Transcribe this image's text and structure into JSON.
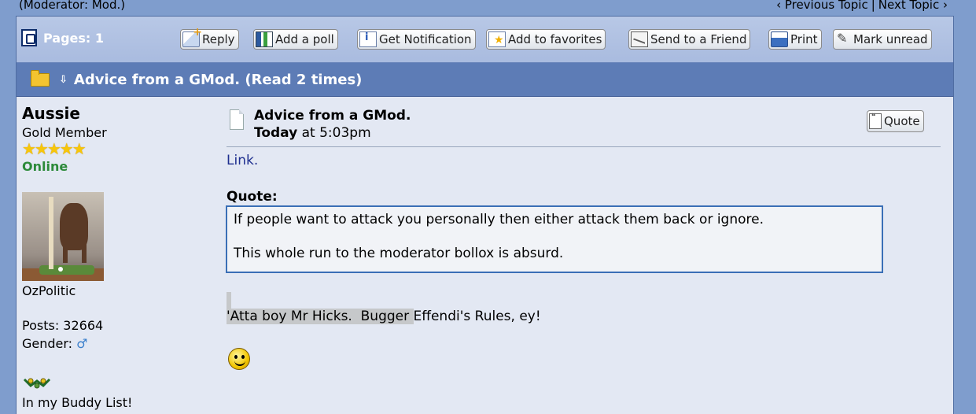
{
  "top": {
    "moderator": "(Moderator: Mod.)",
    "previous_topic": "‹ Previous Topic",
    "separator": "|",
    "next_topic": "Next Topic ›"
  },
  "toolbar": {
    "pages_label": "Pages: 1",
    "buttons": {
      "reply": "Reply",
      "add_poll": "Add a poll",
      "notify": "Get Notification",
      "favorites": "Add to favorites",
      "send": "Send to a Friend",
      "print": "Print",
      "mark_unread": "Mark unread"
    }
  },
  "thread": {
    "title": "Advice from a GMod. (Read 2 times)"
  },
  "user": {
    "name": "Aussie",
    "rank": "Gold Member",
    "stars": "★★★★★",
    "star_count": 5,
    "status": "Online",
    "location": "OzPolitic",
    "posts": "Posts: 32664",
    "gender_label": "Gender:",
    "gender_icon": "male-icon",
    "buddy": "In my Buddy List!"
  },
  "post": {
    "title": "Advice from a GMod.",
    "date_bold": "Today",
    "date_rest": "at 5:03pm",
    "quote_button": "Quote",
    "link": "Link.",
    "quote_label": "Quote:",
    "quote_lines": [
      "If people want to attack you personally then either attack them back or ignore.",
      "This whole run to the moderator bollox is absurd."
    ],
    "signature_highlight": "'Atta boy Mr Hicks.  Bugger ",
    "signature_rest": "Effendi's Rules, ey!",
    "smiley": "smiley-icon"
  },
  "colors": {
    "page_bg": "#7f9dcd",
    "title_bar": "#5d7cb6",
    "toolbar": "#a9bbdf",
    "content_bg": "#e3e8f3",
    "online_green": "#2c8a3a",
    "quote_border": "#3a6fb6"
  }
}
